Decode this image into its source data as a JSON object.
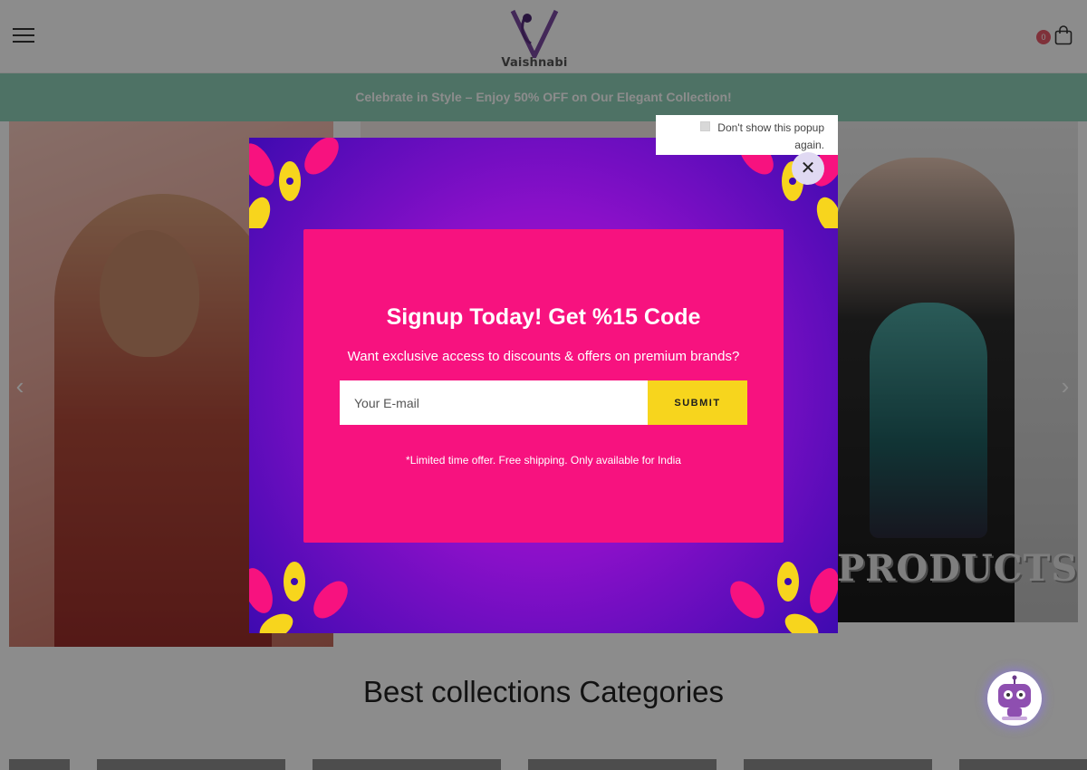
{
  "header": {
    "menu_icon": "hamburger-menu-icon",
    "logo": {
      "text": "Vaishnabi",
      "letter": "V"
    },
    "cart": {
      "count": "0",
      "icon": "shopping-bag-icon"
    }
  },
  "announcement": {
    "text": "Celebrate in Style – Enjoy 50% OFF on Our Elegant Collection!"
  },
  "hero": {
    "prev_icon": "chevron-left-icon",
    "next_icon": "chevron-right-icon",
    "banner_text": "PRODUCTS"
  },
  "categories": {
    "title": "Best collections Categories"
  },
  "popup": {
    "dont_show_label": "Don't show this popup again.",
    "close_icon": "close-icon",
    "title": "Signup Today! Get %15 Code",
    "subtitle": "Want exclusive access to discounts & offers on premium brands?",
    "email_placeholder": "Your E-mail",
    "submit_label": "SUBMIT",
    "note": "*Limited time offer. Free shipping. Only available for India"
  },
  "chatbot": {
    "icon": "chatbot-robot-icon"
  },
  "colors": {
    "announcement_bg": "#8fd0b8",
    "popup_card": "#f7127f",
    "submit_bg": "#f7d51d",
    "popup_bg": "#3e0ab0"
  }
}
